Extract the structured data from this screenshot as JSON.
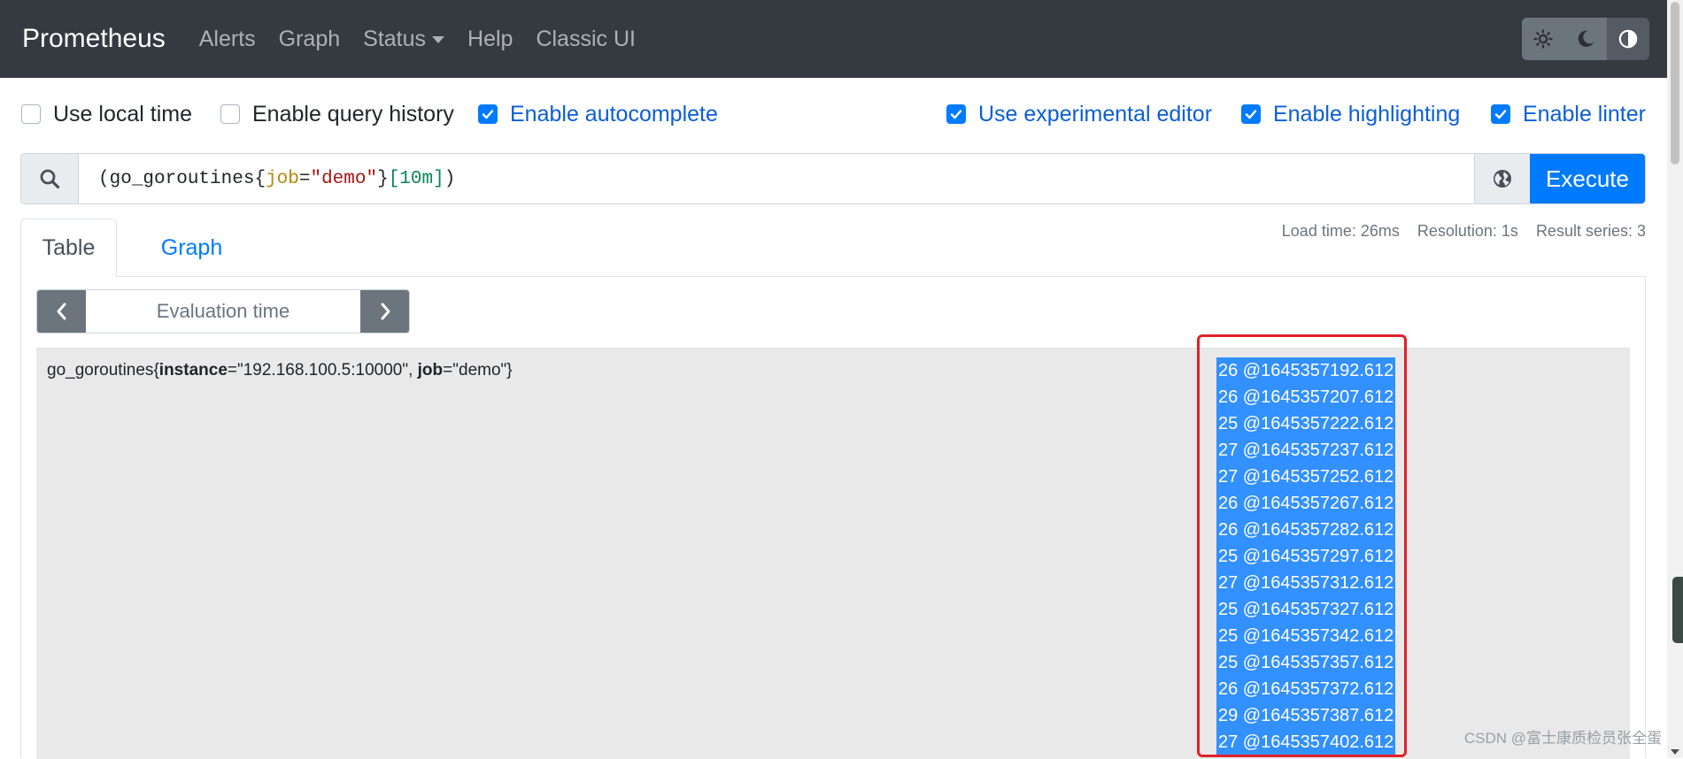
{
  "navbar": {
    "brand": "Prometheus",
    "links": [
      {
        "label": "Alerts"
      },
      {
        "label": "Graph"
      },
      {
        "label": "Status",
        "dropdown": true
      },
      {
        "label": "Help"
      },
      {
        "label": "Classic UI"
      }
    ],
    "theme_buttons": [
      {
        "icon": "sun-icon",
        "active": false
      },
      {
        "icon": "moon-icon",
        "active": false
      },
      {
        "icon": "contrast-icon",
        "active": true
      }
    ]
  },
  "options": [
    {
      "label": "Use local time",
      "checked": false
    },
    {
      "label": "Enable query history",
      "checked": false
    },
    {
      "label": "Enable autocomplete",
      "checked": true
    },
    {
      "label": "Use experimental editor",
      "checked": true
    },
    {
      "label": "Enable highlighting",
      "checked": true
    },
    {
      "label": "Enable linter",
      "checked": true
    }
  ],
  "query": {
    "open_paren": "(",
    "metric": "go_goroutines",
    "brace_open": "{",
    "label_name": "job",
    "equals": "=",
    "label_value": "\"demo\"",
    "brace_close": "}",
    "range": "[10m]",
    "close_paren": ")",
    "execute_label": "Execute"
  },
  "tabs": {
    "table": "Table",
    "graph": "Graph",
    "active": "Table"
  },
  "stats": {
    "load_time": "Load time: 26ms",
    "resolution": "Resolution: 1s",
    "result_series": "Result series: 3"
  },
  "evaluation": {
    "placeholder": "Evaluation time"
  },
  "result": {
    "series": {
      "metric": "go_goroutines",
      "brace_open": "{",
      "l1_name": "instance",
      "l1_value": "=\"192.168.100.5:10000\", ",
      "l2_name": "job",
      "l2_value": "=\"demo\"",
      "brace_close": "}"
    },
    "values": [
      "26 @1645357192.612",
      "26 @1645357207.612",
      "25 @1645357222.612",
      "27 @1645357237.612",
      "27 @1645357252.612",
      "26 @1645357267.612",
      "26 @1645357282.612",
      "25 @1645357297.612",
      "27 @1645357312.612",
      "25 @1645357327.612",
      "25 @1645357342.612",
      "25 @1645357357.612",
      "26 @1645357372.612",
      "29 @1645357387.612",
      "27 @1645357402.612"
    ]
  },
  "watermark": "CSDN @富士康质检员张全蛋",
  "colors": {
    "navbar": "#343a40",
    "primary": "#007bff",
    "selection": "#3390ff",
    "highlight_box": "#e0212b"
  }
}
